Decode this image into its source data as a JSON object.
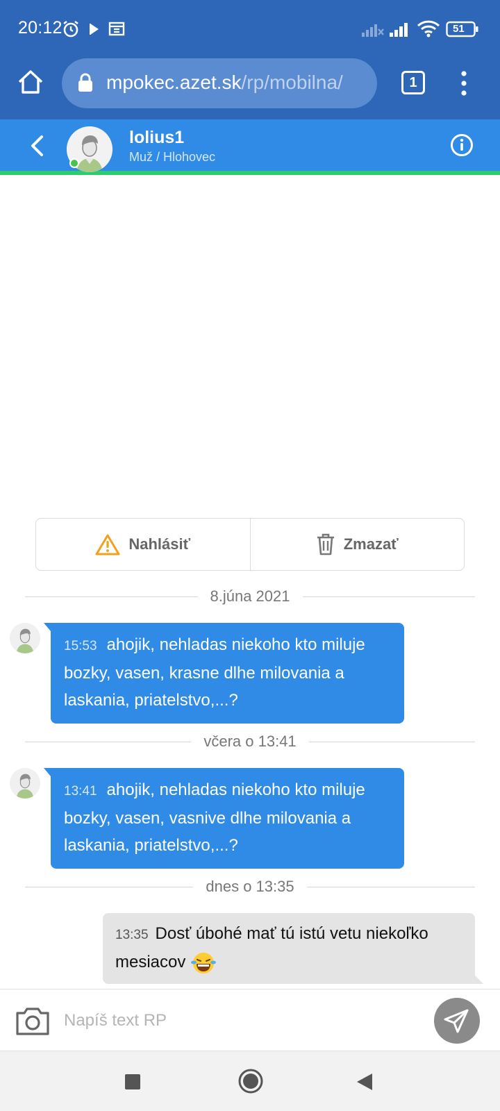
{
  "status_bar": {
    "time": "20:12",
    "battery": "51"
  },
  "browser": {
    "url_host": "mpokec.azet.sk",
    "url_path": "/rp/mobilna/",
    "tab_count": "1"
  },
  "chat_header": {
    "name": "lolius1",
    "subtitle": "Muž / Hlohovec"
  },
  "actions": {
    "report_label": "Nahlásiť",
    "delete_label": "Zmazať"
  },
  "messages": [
    {
      "divider": "8.júna 2021",
      "time": "15:53",
      "text": "ahojik, nehladas niekoho kto miluje bozky, vasen, krasne dlhe milovania a laskania, priatelstvo,...?"
    },
    {
      "divider": "včera o 13:41",
      "time": "13:41",
      "text": "ahojik, nehladas niekoho kto miluje bozky, vasen, vasnive dlhe milovania a laskania, priatelstvo,...?"
    },
    {
      "divider": "dnes o 13:35",
      "time": "13:35",
      "text": "Dosť úbohé mať tú istú vetu niekoľko mesiacov"
    }
  ],
  "composer": {
    "placeholder": "Napíš text RP"
  },
  "colors": {
    "status_bar": "#2f67b8",
    "chat_header": "#2f8be6",
    "online_strip": "#2ecc71",
    "bubble_incoming": "#2f8be6",
    "bubble_outgoing": "#e4e4e4",
    "warning": "#f0a21d"
  },
  "icons": [
    "alarm-icon",
    "play-icon",
    "calendar-icon",
    "signal-icon",
    "wifi-icon",
    "battery-icon",
    "home-icon",
    "lock-icon",
    "tabs-icon",
    "more-icon",
    "back-icon",
    "info-icon",
    "warning-icon",
    "trash-icon",
    "camera-icon",
    "send-icon",
    "laughing-emoji-icon",
    "recents-icon",
    "home-nav-icon",
    "back-nav-icon"
  ]
}
